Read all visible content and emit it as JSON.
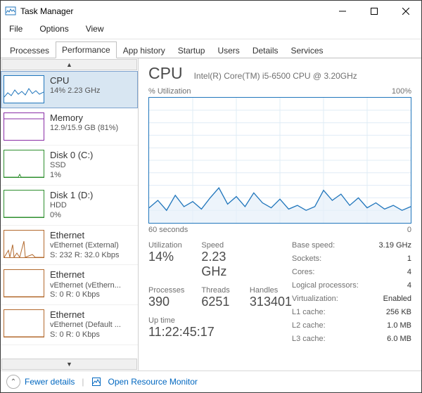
{
  "window": {
    "title": "Task Manager"
  },
  "menubar": [
    "File",
    "Options",
    "View"
  ],
  "tabs": [
    "Processes",
    "Performance",
    "App history",
    "Startup",
    "Users",
    "Details",
    "Services"
  ],
  "sidebar": {
    "items": [
      {
        "title": "CPU",
        "sub1": "14%  2.23 GHz",
        "sub2": "",
        "color": "#2176bc",
        "selected": true,
        "spark": "cpu"
      },
      {
        "title": "Memory",
        "sub1": "12.9/15.9 GB (81%)",
        "sub2": "",
        "color": "#8a2da6",
        "selected": false,
        "spark": "mem"
      },
      {
        "title": "Disk 0 (C:)",
        "sub1": "SSD",
        "sub2": "1%",
        "color": "#2f8f2f",
        "selected": false,
        "spark": "disk0"
      },
      {
        "title": "Disk 1 (D:)",
        "sub1": "HDD",
        "sub2": "0%",
        "color": "#2f8f2f",
        "selected": false,
        "spark": "flat"
      },
      {
        "title": "Ethernet",
        "sub1": "vEthernet (External)",
        "sub2": "S: 232 R: 32.0 Kbps",
        "color": "#b36a2e",
        "selected": false,
        "spark": "eth1"
      },
      {
        "title": "Ethernet",
        "sub1": "vEthernet (vEthern...",
        "sub2": "S: 0 R: 0 Kbps",
        "color": "#b36a2e",
        "selected": false,
        "spark": "flat"
      },
      {
        "title": "Ethernet",
        "sub1": "vEthernet (Default ...",
        "sub2": "S: 0 R: 0 Kbps",
        "color": "#b36a2e",
        "selected": false,
        "spark": "flat"
      }
    ]
  },
  "main": {
    "title": "CPU",
    "model": "Intel(R) Core(TM) i5-6500 CPU @ 3.20GHz",
    "chart": {
      "ylabel": "% Utilization",
      "ymax": "100%",
      "xleft": "60 seconds",
      "xright": "0"
    },
    "stats": {
      "util_lbl": "Utilization",
      "util": "14%",
      "speed_lbl": "Speed",
      "speed": "2.23 GHz",
      "proc_lbl": "Processes",
      "proc": "390",
      "thr_lbl": "Threads",
      "thr": "6251",
      "hnd_lbl": "Handles",
      "hnd": "313401",
      "up_lbl": "Up time",
      "up": "11:22:45:17"
    },
    "details": [
      {
        "k": "Base speed:",
        "v": "3.19 GHz"
      },
      {
        "k": "Sockets:",
        "v": "1"
      },
      {
        "k": "Cores:",
        "v": "4"
      },
      {
        "k": "Logical processors:",
        "v": "4"
      },
      {
        "k": "Virtualization:",
        "v": "Enabled"
      },
      {
        "k": "L1 cache:",
        "v": "256 KB"
      },
      {
        "k": "L2 cache:",
        "v": "1.0 MB"
      },
      {
        "k": "L3 cache:",
        "v": "6.0 MB"
      }
    ]
  },
  "footer": {
    "fewer": "Fewer details",
    "resmon": "Open Resource Monitor"
  },
  "chart_data": {
    "type": "line",
    "title": "% Utilization",
    "xlabel": "seconds",
    "ylabel": "% Utilization",
    "xlim": [
      60,
      0
    ],
    "ylim": [
      0,
      100
    ],
    "x": [
      60,
      58,
      56,
      54,
      52,
      50,
      48,
      46,
      44,
      42,
      40,
      38,
      36,
      34,
      32,
      30,
      28,
      26,
      24,
      22,
      20,
      18,
      16,
      14,
      12,
      10,
      8,
      6,
      4,
      2,
      0
    ],
    "values": [
      12,
      18,
      10,
      22,
      13,
      17,
      11,
      20,
      28,
      15,
      21,
      13,
      24,
      16,
      12,
      19,
      11,
      14,
      10,
      13,
      26,
      18,
      23,
      14,
      20,
      12,
      16,
      11,
      14,
      10,
      13
    ]
  },
  "colors": {
    "cpu": "#2176bc",
    "grid": "#e0ecf6"
  }
}
